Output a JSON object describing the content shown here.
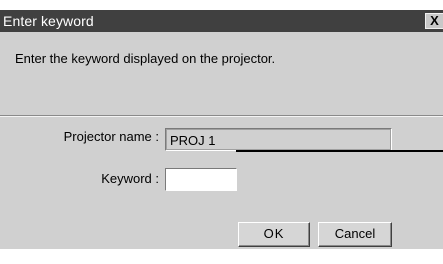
{
  "dialog": {
    "title": "Enter keyword",
    "close_icon": "close-icon",
    "close_label": "X",
    "message": "Enter the keyword displayed on the projector."
  },
  "form": {
    "projector_name_label": "Projector name :",
    "projector_name_value": "PROJ 1",
    "keyword_label": "Keyword :",
    "keyword_value": ""
  },
  "buttons": {
    "ok_label": "OK",
    "cancel_label": "Cancel"
  },
  "colors": {
    "titlebar": "#404040",
    "dialog_background": "#d0d0d0",
    "callout_line": "#000000"
  }
}
